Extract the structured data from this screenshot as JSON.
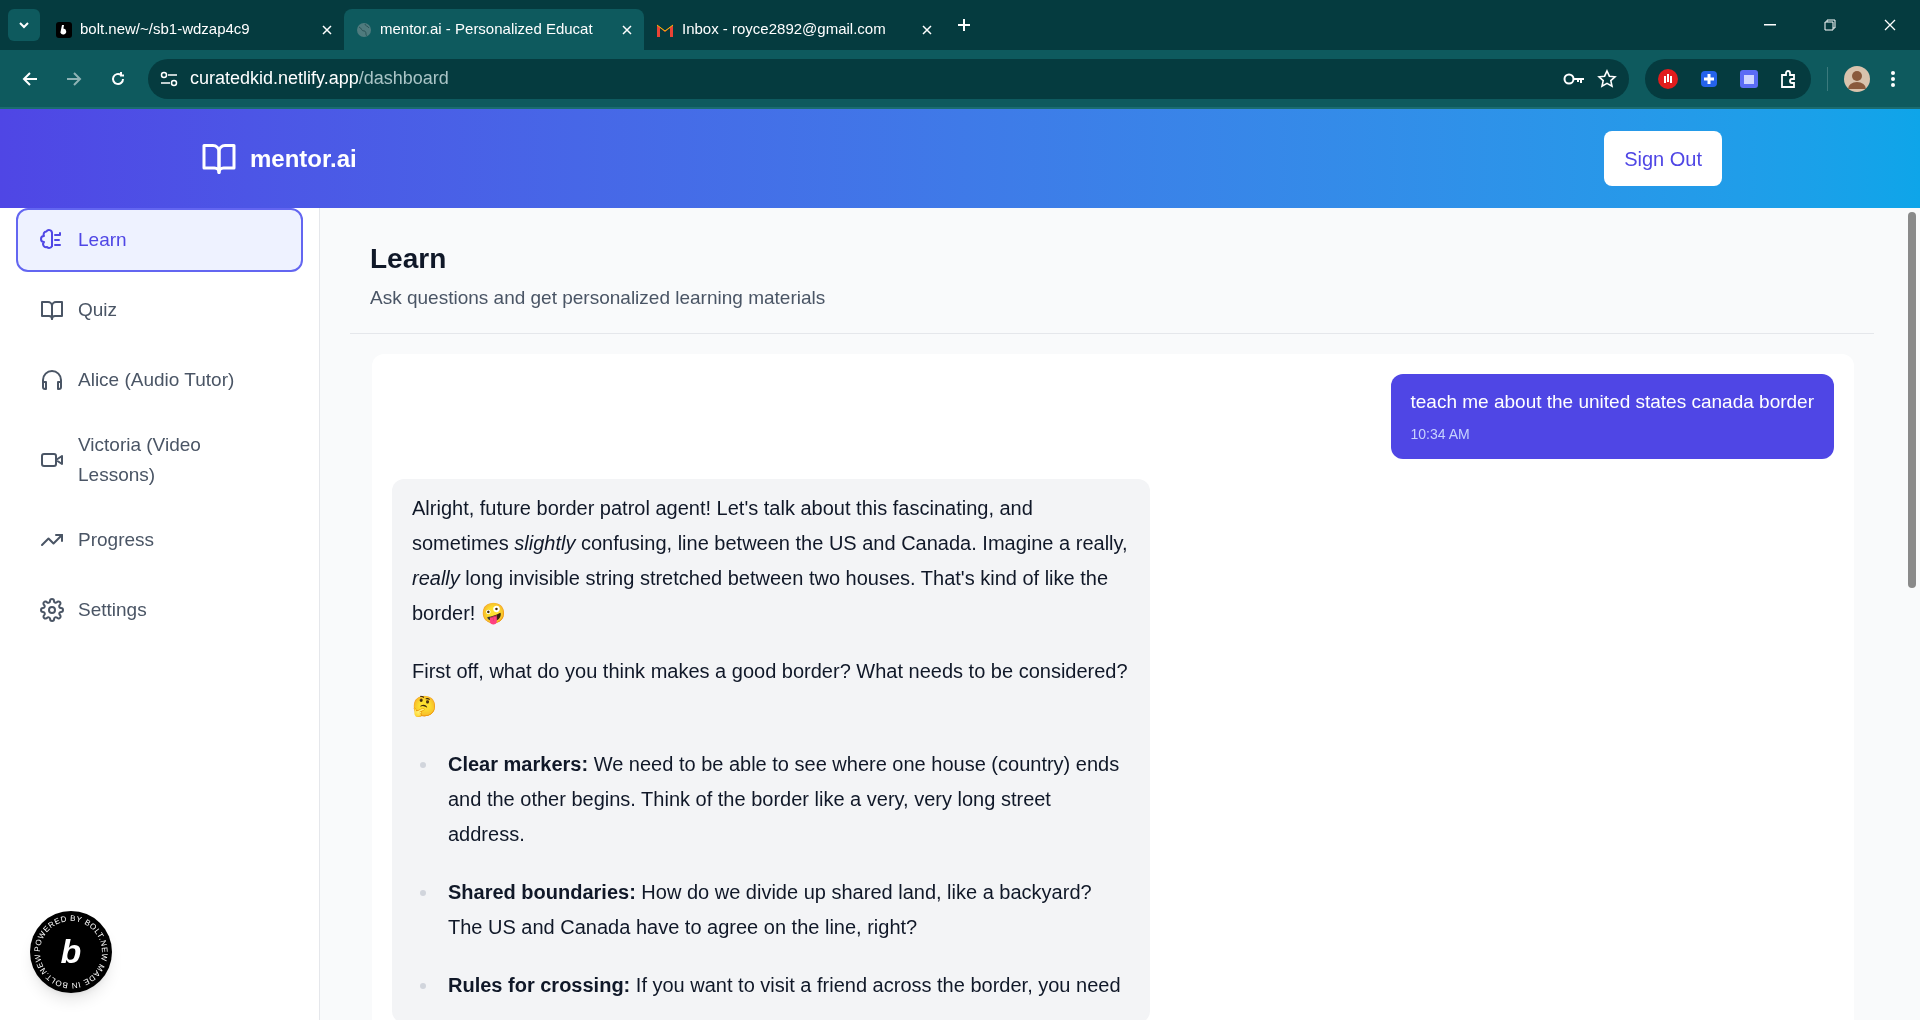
{
  "browser": {
    "tabs": [
      {
        "title": "bolt.new/~/sb1-wdzap4c9",
        "selected": false
      },
      {
        "title": "mentor.ai - Personalized Educat",
        "selected": true
      },
      {
        "title": "Inbox - royce2892@gmail.com",
        "selected": false
      }
    ],
    "url_host": "curatedkid.netlify.app",
    "url_path": "/dashboard"
  },
  "app": {
    "brand": "mentor.ai",
    "sign_out": "Sign Out"
  },
  "sidebar": {
    "items": [
      {
        "label": "Learn",
        "selected": true
      },
      {
        "label": "Quiz",
        "selected": false
      },
      {
        "label": "Alice (Audio Tutor)",
        "selected": false
      },
      {
        "label": "Victoria (Video Lessons)",
        "selected": false
      },
      {
        "label": "Progress",
        "selected": false
      },
      {
        "label": "Settings",
        "selected": false
      }
    ]
  },
  "page": {
    "title": "Learn",
    "subtitle": "Ask questions and get personalized learning materials"
  },
  "messages": [
    {
      "kind": "user",
      "text": "teach me about the united states canada border",
      "time": "10:34 AM"
    },
    {
      "kind": "assistant",
      "blocks": [
        {
          "kind": "paragraph",
          "text": "Alright, future border patrol agent! Let's talk about this fascinating, and sometimes *slightly* confusing, line between the US and Canada. Imagine a really, *really* long invisible string stretched between two houses. That's kind of like the border! 🤪"
        },
        {
          "kind": "paragraph",
          "text": "First off, what do you think makes a good border? What needs to be considered? 🤔"
        },
        {
          "kind": "bullet",
          "text": "**Clear markers:** We need to be able to see where one house (country) ends and the other begins. Think of the border like a very, very long street address."
        },
        {
          "kind": "bullet",
          "text": "**Shared boundaries:** How do we divide up shared land, like a backyard? The US and Canada have to agree on the line, right?"
        },
        {
          "kind": "bullet",
          "text": "**Rules for crossing:** If you want to visit a friend across the border, you need"
        }
      ]
    }
  ],
  "badge": {
    "ring_text": "POWERED BY BOLT.NEW MADE IN BOLT.NEW",
    "letter": "b"
  }
}
